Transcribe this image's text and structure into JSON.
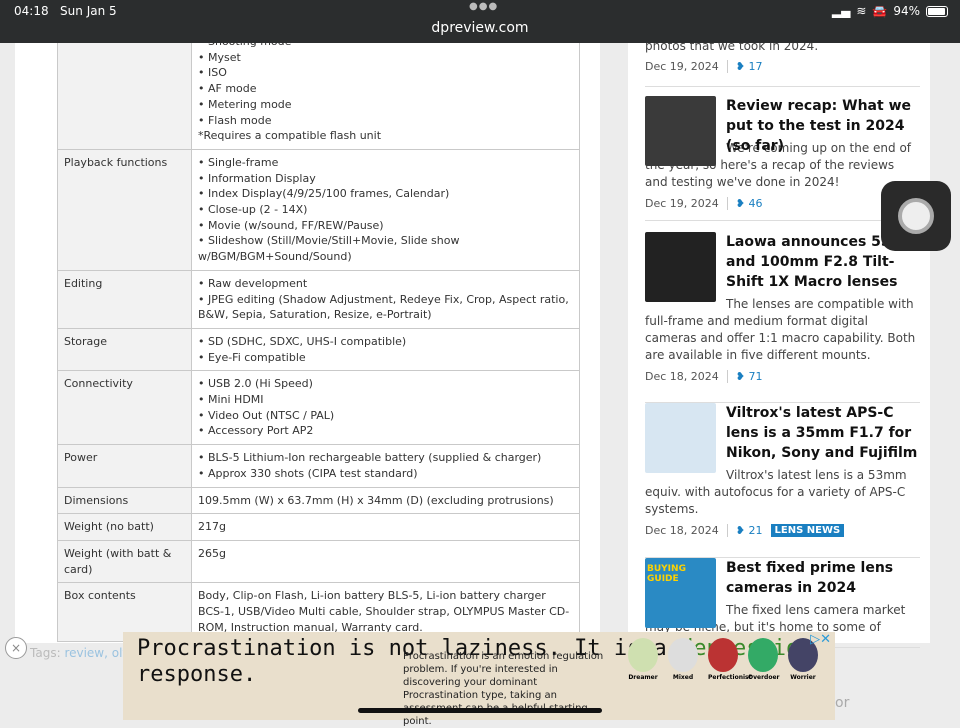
{
  "status_bar": {
    "time": "04:18",
    "date": "Sun Jan 5",
    "battery": "94%",
    "url": "dpreview.com",
    "battery_level": 0.94
  },
  "specs": [
    {
      "label": "",
      "lines": [
        "• Shooting mode",
        "• Myset",
        "• ISO",
        "• AF mode",
        "• Metering mode",
        "• Flash mode",
        "*Requires a compatible flash unit"
      ]
    },
    {
      "label": "Playback functions",
      "lines": [
        "• Single-frame",
        "• Information Display",
        "• Index Display(4/9/25/100 frames, Calendar)",
        "• Close-up (2 - 14X)",
        "• Movie (w/sound, FF/REW/Pause)",
        "• Slideshow (Still/Movie/Still+Movie, Slide show w/BGM/BGM+Sound/Sound)"
      ]
    },
    {
      "label": "Editing",
      "lines": [
        "• Raw development",
        "• JPEG editing (Shadow Adjustment, Redeye Fix, Crop, Aspect ratio, B&W, Sepia, Saturation, Resize, e-Portrait)"
      ]
    },
    {
      "label": "Storage",
      "lines": [
        "• SD (SDHC, SDXC, UHS-I compatible)",
        "• Eye-Fi compatible"
      ]
    },
    {
      "label": "Connectivity",
      "lines": [
        "• USB 2.0 (Hi Speed)",
        "• Mini HDMI",
        "• Video Out (NTSC / PAL)",
        "• Accessory Port AP2"
      ]
    },
    {
      "label": "Power",
      "lines": [
        "• BLS-5 Lithium-Ion rechargeable battery (supplied & charger)",
        "• Approx 330 shots (CIPA test standard)"
      ]
    },
    {
      "label": "Dimensions",
      "lines": [
        "109.5mm (W) x 63.7mm (H) x 34mm (D) (excluding protrusions)"
      ]
    },
    {
      "label": "Weight (no batt)",
      "lines": [
        "217g"
      ]
    },
    {
      "label": "Weight (with batt & card)",
      "lines": [
        "265g"
      ]
    },
    {
      "label": "Box contents",
      "lines": [
        "Body, Clip-on Flash, Li-ion battery BLS-5, Li-ion battery charger BCS-1, USB/Video Multi cable, Shoulder strap, OLYMPUS Master CD-ROM, Instruction manual, Warranty card."
      ]
    }
  ],
  "tags": {
    "label": "Tags:",
    "values": "review, oly"
  },
  "sidebar": {
    "first": {
      "desc": "photos that we took in 2024.",
      "date": "Dec 19, 2024",
      "comments": "17"
    },
    "items": [
      {
        "title": "Review recap: What we put to the test in 2024 (so far)",
        "desc": "We're coming up on the end of the year, so here's a recap of the reviews and testing we've done in 2024!",
        "date": "Dec 19, 2024",
        "comments": "46"
      },
      {
        "title": "Laowa announces 55mm and 100mm F2.8 Tilt-Shift 1X Macro lenses",
        "desc": "The lenses are compatible with full-frame and medium format digital cameras and offer 1:1 macro capability. Both are available in five different mounts.",
        "date": "Dec 18, 2024",
        "comments": "71"
      },
      {
        "title": "Viltrox's latest APS-C lens is a 35mm F1.7 for Nikon, Sony and Fujifilm",
        "desc": "Viltrox's latest lens is a 53mm equiv. with autofocus for a variety of APS-C systems.",
        "date": "Dec 18, 2024",
        "comments": "21",
        "badge": "LENS NEWS"
      },
      {
        "title": "Best fixed prime lens cameras in 2024",
        "desc": "The fixed lens camera market may be niche, but it's home to some of",
        "thumb_text": "BUYING GUIDE"
      }
    ],
    "partial_text": "or"
  },
  "ad": {
    "headline_1": "Procrastination is not laziness. It is a",
    "headline_green": "depression",
    "headline_2": " response.",
    "body": "Procrastination is an emotion regulation problem. If you're interested in discovering your dominant Procrastination type, taking an assessment can be a helpful starting point.",
    "types": [
      "Dreamer",
      "Mixed",
      "Perfectionist",
      "Overdoer",
      "Worrier"
    ],
    "close": "×"
  }
}
